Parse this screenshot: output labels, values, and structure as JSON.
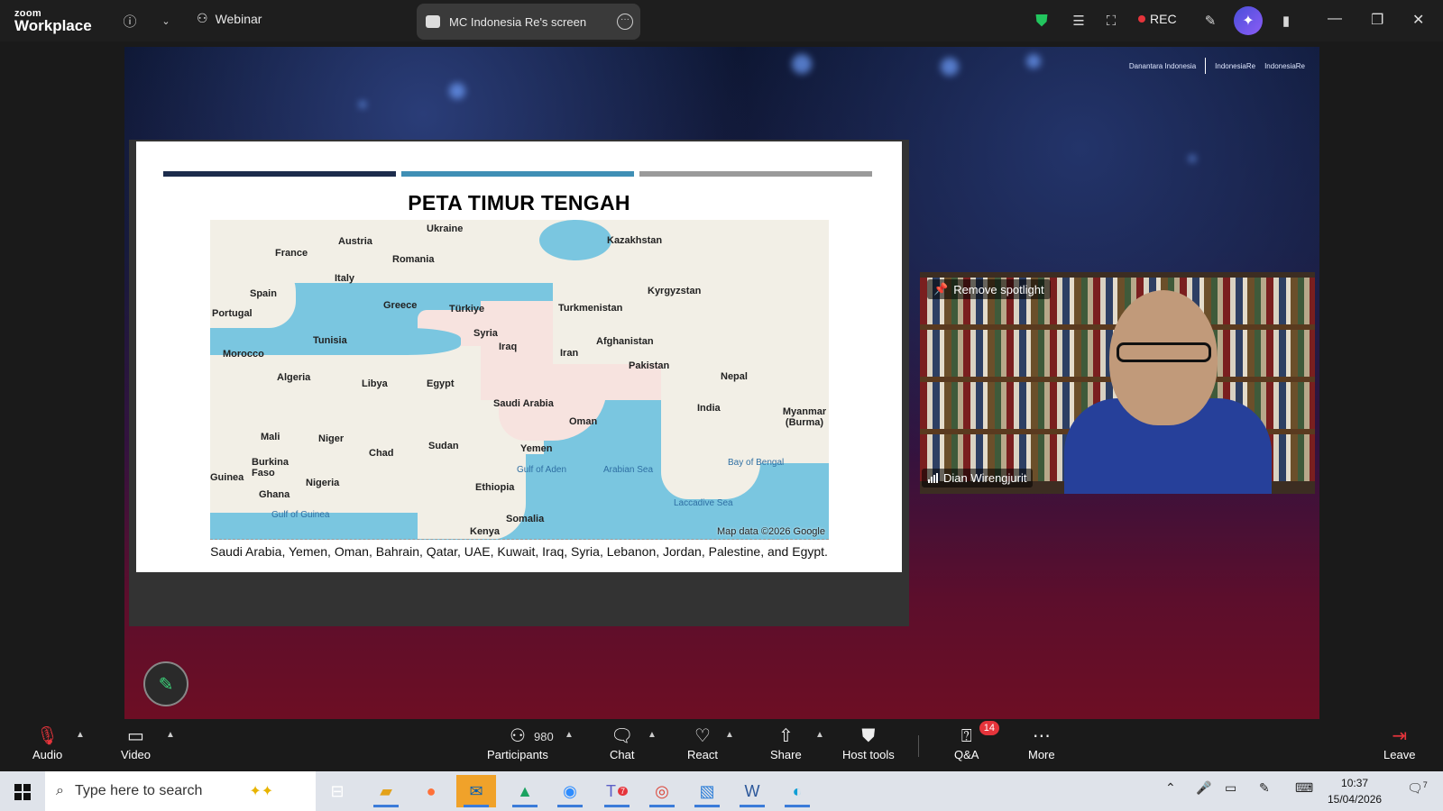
{
  "app": {
    "logo_top": "zoom",
    "logo_bottom": "Workplace"
  },
  "topbar": {
    "webinar_label": "Webinar",
    "screen_tab_label": "MC Indonesia Re's screen",
    "rec_label": "REC"
  },
  "stage": {
    "brand_logos": [
      "Danantara Indonesia",
      "IndonesiaRe",
      "IndonesiaRe"
    ]
  },
  "slide": {
    "title": "PETA TIMUR TENGAH",
    "bar_colors": [
      "#1c2c4c",
      "#3f8fb5",
      "#9a9a9a"
    ],
    "map_credit": "Map data ©2026 Google",
    "caption": "Saudi Arabia, Yemen, Oman, Bahrain, Qatar, UAE, Kuwait, Iraq, Syria, Lebanon, Jordan, Palestine, and Egypt.",
    "countries": [
      "Ukraine",
      "Kazakhstan",
      "Austria",
      "France",
      "Romania",
      "Italy",
      "Spain",
      "Kyrgyzstan",
      "Portugal",
      "Greece",
      "Türkiye",
      "Turkmenistan",
      "Syria",
      "Tunisia",
      "Iraq",
      "Afghanistan",
      "Iran",
      "Morocco",
      "Algeria",
      "Libya",
      "Egypt",
      "Pakistan",
      "Nepal",
      "India",
      "Saudi Arabia",
      "Myanmar (Burma)",
      "Oman",
      "Mali",
      "Niger",
      "Chad",
      "Sudan",
      "Yemen",
      "Burkina Faso",
      "Nigeria",
      "Ethiopia",
      "Guinea",
      "Ghana",
      "Somalia",
      "Kenya"
    ],
    "seas": [
      "Arabian Sea",
      "Bay of Bengal",
      "Gulf of Aden",
      "Laccadive Sea",
      "Gulf of Guinea"
    ]
  },
  "video": {
    "remove_spotlight": "Remove spotlight",
    "participant_name": "Dian Wirengjurit"
  },
  "toolbar": {
    "audio": "Audio",
    "video": "Video",
    "participants": "Participants",
    "participants_count": "980",
    "chat": "Chat",
    "react": "React",
    "share": "Share",
    "host_tools": "Host tools",
    "qa": "Q&A",
    "qa_badge": "14",
    "more": "More",
    "leave": "Leave"
  },
  "taskbar": {
    "search_placeholder": "Type here to search",
    "time": "10:37",
    "date": "15/04/2026",
    "teams_badge": "7",
    "notif_badge": "7"
  },
  "colors": {
    "rec_dot": "#e5343b",
    "shield": "#22c55e",
    "leave": "#e5343b"
  }
}
